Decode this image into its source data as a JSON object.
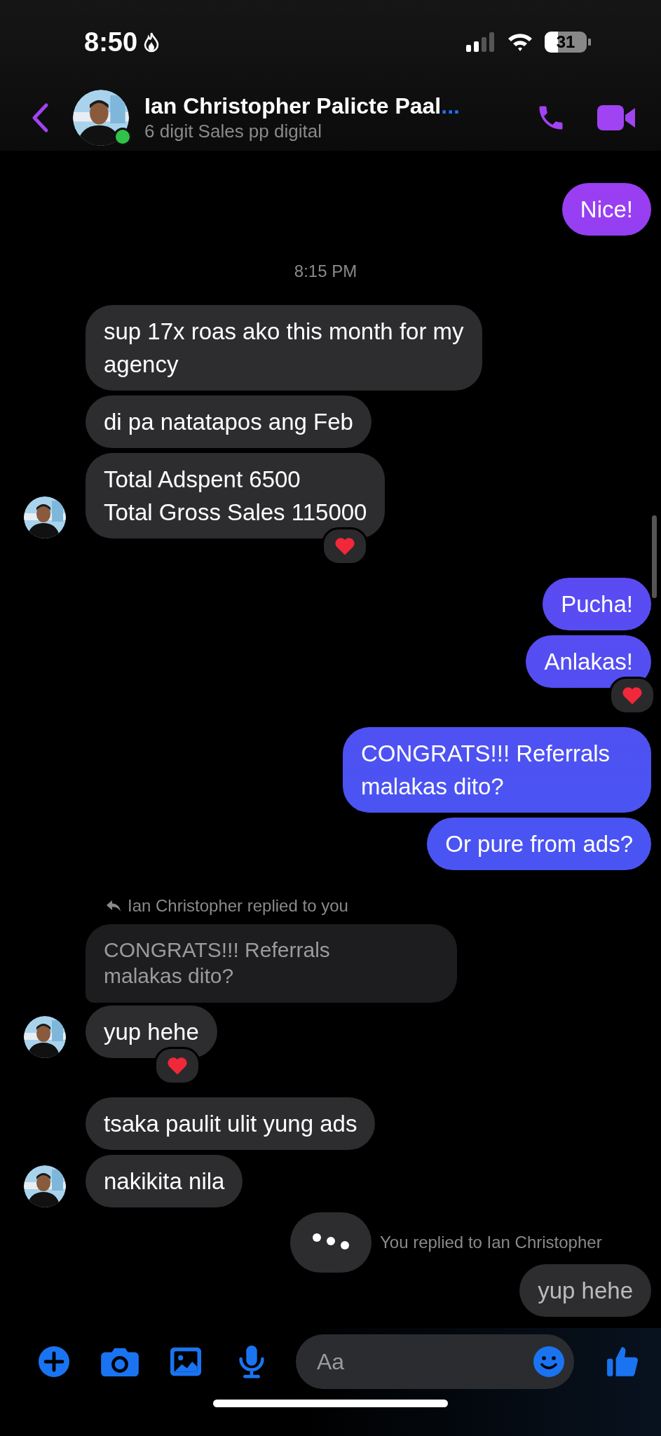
{
  "status_bar": {
    "time": "8:50",
    "battery": "31"
  },
  "header": {
    "name": "Ian Christopher Palicte Paal",
    "ellipsis": "...",
    "subtitle": "6 digit Sales pp digital",
    "online": true
  },
  "messages": [
    {
      "kind": "out",
      "text": "Nice!",
      "reacted": false
    },
    {
      "kind": "time",
      "text": "8:15 PM"
    },
    {
      "kind": "in",
      "text": "sup 17x roas ako this month for my agency",
      "reacted": false,
      "avatar": false
    },
    {
      "kind": "in",
      "text": "di pa natatapos ang Feb",
      "reacted": false,
      "avatar": false
    },
    {
      "kind": "in",
      "text": "Total Adspent 6500\nTotal Gross Sales 115000",
      "reacted": true,
      "avatar": true
    },
    {
      "kind": "out",
      "text": "Pucha!",
      "reacted": false
    },
    {
      "kind": "out",
      "text": "Anlakas!",
      "reacted": true
    },
    {
      "kind": "out",
      "text": "CONGRATS!!! Referrals malakas dito?",
      "reacted": false
    },
    {
      "kind": "out",
      "text": "Or pure from ads?",
      "reacted": false
    },
    {
      "kind": "reply_note",
      "text": "Ian Christopher replied to you"
    },
    {
      "kind": "in",
      "quote": "CONGRATS!!! Referrals\nmalakas dito?",
      "text": "yup hehe",
      "reacted": true,
      "avatar": true
    },
    {
      "kind": "in",
      "text": "tsaka paulit ulit yung ads",
      "reacted": false,
      "avatar": false
    },
    {
      "kind": "in",
      "text": "nakikita nila",
      "reacted": false,
      "avatar": true
    },
    {
      "kind": "typing",
      "note": "You replied to Ian Christopher"
    },
    {
      "kind": "out_partial",
      "text": "yup hehe"
    }
  ],
  "composer": {
    "placeholder": "Aa"
  }
}
